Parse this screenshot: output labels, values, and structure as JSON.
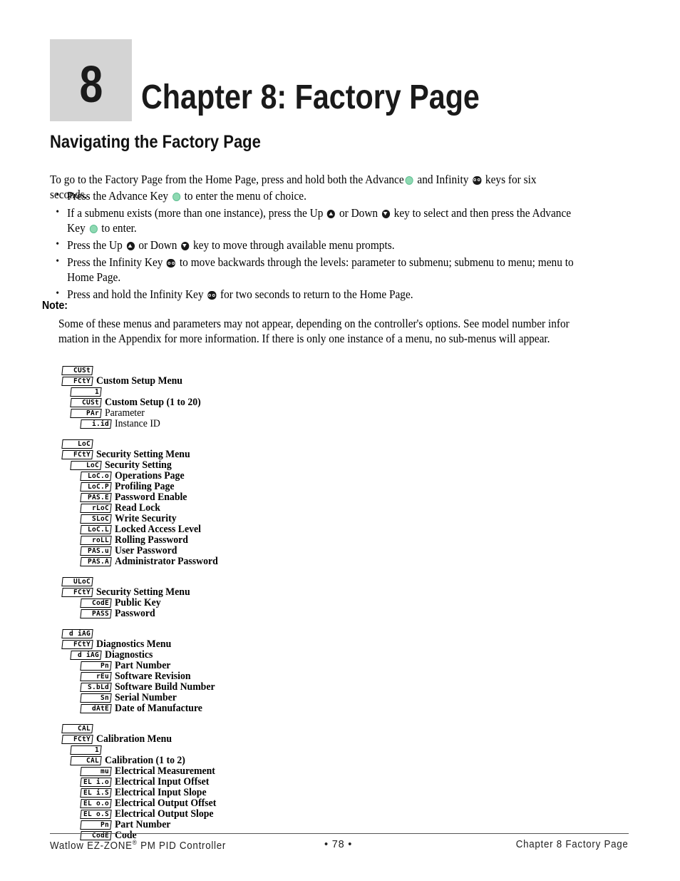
{
  "chapter": {
    "number": "8",
    "title": "Chapter 8: Factory Page"
  },
  "section_heading": "Navigating the Factory Page",
  "intro": {
    "before_advance": "To go to the Factory Page from the Home Page, press and hold both the Advance",
    "between": "and Infinity",
    "after": "keys for six seconds."
  },
  "bullets": [
    {
      "p1": "Press the Advance Key",
      "icons": [
        "advance-icon"
      ],
      "p2": "to enter the menu of choice.",
      "p3": "",
      "p4": ""
    },
    {
      "p1": "If a submenu exists (more than one instance), press the Up",
      "icons": [
        "up-icon",
        "down-icon",
        "advance-icon"
      ],
      "p2": "or Down",
      "p3": "key to select and then press the Advance Key",
      "p4": "to enter."
    },
    {
      "p1": "Press the Up",
      "icons": [
        "up-icon",
        "down-icon"
      ],
      "p2": "or Down",
      "p3": "key to move through available menu prompts.",
      "p4": ""
    },
    {
      "p1": "Press the Infinity Key",
      "icons": [
        "infinity-icon"
      ],
      "p2": "to move backwards through the levels: parameter to submenu; submenu to menu; menu to Home Page.",
      "p3": "",
      "p4": ""
    },
    {
      "p1": "Press and hold the Infinity Key",
      "icons": [
        "infinity-icon"
      ],
      "p2": "for two seconds to return to the Home Page.",
      "p3": "",
      "p4": ""
    }
  ],
  "note": {
    "heading": "Note:",
    "body": "Some of these menus and parameters may not appear, depending on the controller's options. See model number infor mation in the Appendix for more information. If there is only one instance of a menu, no sub-menus will appear."
  },
  "menu_tree": [
    {
      "group_name": "custom-setup",
      "rows": [
        {
          "code": "CUSt",
          "label": "",
          "indent": 0,
          "bold": true
        },
        {
          "code": "FCtY",
          "label": "Custom Setup Menu",
          "indent": 0,
          "bold": true
        },
        {
          "code": "1",
          "label": "",
          "indent": 1,
          "bold": true
        },
        {
          "code": "CUSt",
          "label": "Custom Setup (1 to 20)",
          "indent": 1,
          "bold": true
        },
        {
          "code": "PAr",
          "label": "Parameter",
          "indent": 1,
          "bold": false
        },
        {
          "code": "i.id",
          "label": "Instance ID",
          "indent": 2,
          "bold": false
        }
      ]
    },
    {
      "group_name": "security-setting",
      "rows": [
        {
          "code": "LoC",
          "label": "",
          "indent": 0,
          "bold": true
        },
        {
          "code": "FCtY",
          "label": "Security Setting Menu",
          "indent": 0,
          "bold": true
        },
        {
          "code": "LoC",
          "label": "Security Setting",
          "indent": 1,
          "bold": true
        },
        {
          "code": "LoC.o",
          "label": "Operations Page",
          "indent": 2,
          "bold": true
        },
        {
          "code": "LoC.P",
          "label": "Profiling Page",
          "indent": 2,
          "bold": true
        },
        {
          "code": "PAS.E",
          "label": "Password Enable",
          "indent": 2,
          "bold": true
        },
        {
          "code": "rLoC",
          "label": "Read Lock",
          "indent": 2,
          "bold": true
        },
        {
          "code": "SLoC",
          "label": "Write Security",
          "indent": 2,
          "bold": true
        },
        {
          "code": "LoC.L",
          "label": "Locked Access Level",
          "indent": 2,
          "bold": true
        },
        {
          "code": "roLL",
          "label": "Rolling Password",
          "indent": 2,
          "bold": true
        },
        {
          "code": "PAS.u",
          "label": "User Password",
          "indent": 2,
          "bold": true
        },
        {
          "code": "PAS.A",
          "label": "Administrator Password",
          "indent": 2,
          "bold": true
        }
      ]
    },
    {
      "group_name": "unlock-security",
      "rows": [
        {
          "code": "ULoC",
          "label": "",
          "indent": 0,
          "bold": true
        },
        {
          "code": "FCtY",
          "label": "Security Setting Menu",
          "indent": 0,
          "bold": true
        },
        {
          "code": "CodE",
          "label": "Public Key",
          "indent": 2,
          "bold": true
        },
        {
          "code": "PASS",
          "label": "Password",
          "indent": 2,
          "bold": true
        }
      ]
    },
    {
      "group_name": "diagnostics",
      "rows": [
        {
          "code": "d iAG",
          "label": "",
          "indent": 0,
          "bold": true
        },
        {
          "code": "FCtY",
          "label": "Diagnostics Menu",
          "indent": 0,
          "bold": true
        },
        {
          "code": "d iAG",
          "label": "Diagnostics",
          "indent": 1,
          "bold": true
        },
        {
          "code": "Pn",
          "label": "Part Number",
          "indent": 2,
          "bold": true
        },
        {
          "code": "rEu",
          "label": "Software Revision",
          "indent": 2,
          "bold": true
        },
        {
          "code": "S.bLd",
          "label": "Software Build Number",
          "indent": 2,
          "bold": true
        },
        {
          "code": "Sn",
          "label": "Serial Number",
          "indent": 2,
          "bold": true
        },
        {
          "code": "dAtE",
          "label": "Date of Manufacture",
          "indent": 2,
          "bold": true
        }
      ]
    },
    {
      "group_name": "calibration",
      "rows": [
        {
          "code": "CAL",
          "label": "",
          "indent": 0,
          "bold": true
        },
        {
          "code": "FCtY",
          "label": "Calibration Menu",
          "indent": 0,
          "bold": true
        },
        {
          "code": "1",
          "label": "",
          "indent": 1,
          "bold": true
        },
        {
          "code": "CAL",
          "label": "Calibration (1 to 2)",
          "indent": 1,
          "bold": true
        },
        {
          "code": "mu",
          "label": "Electrical Measurement",
          "indent": 2,
          "bold": true
        },
        {
          "code": "EL i.o",
          "label": "Electrical Input Offset",
          "indent": 2,
          "bold": true
        },
        {
          "code": "EL i.S",
          "label": "Electrical Input Slope",
          "indent": 2,
          "bold": true
        },
        {
          "code": "EL o.o",
          "label": "Electrical Output Offset",
          "indent": 2,
          "bold": true
        },
        {
          "code": "EL o.S",
          "label": "Electrical Output Slope",
          "indent": 2,
          "bold": true
        },
        {
          "code": "Pn",
          "label": "Part Number",
          "indent": 2,
          "bold": true
        },
        {
          "code": "CodE",
          "label": "Code",
          "indent": 2,
          "bold": true
        }
      ]
    }
  ],
  "footer": {
    "left_main": "Watlow EZ-ZONE",
    "left_sup": "®",
    "left_rest": " PM PID Controller",
    "center": "•  78  •",
    "right": "Chapter 8 Factory Page"
  },
  "colors": {
    "advance_key": "#8ed9b2",
    "chapter_box": "#d4d4d4",
    "text": "#000000"
  }
}
